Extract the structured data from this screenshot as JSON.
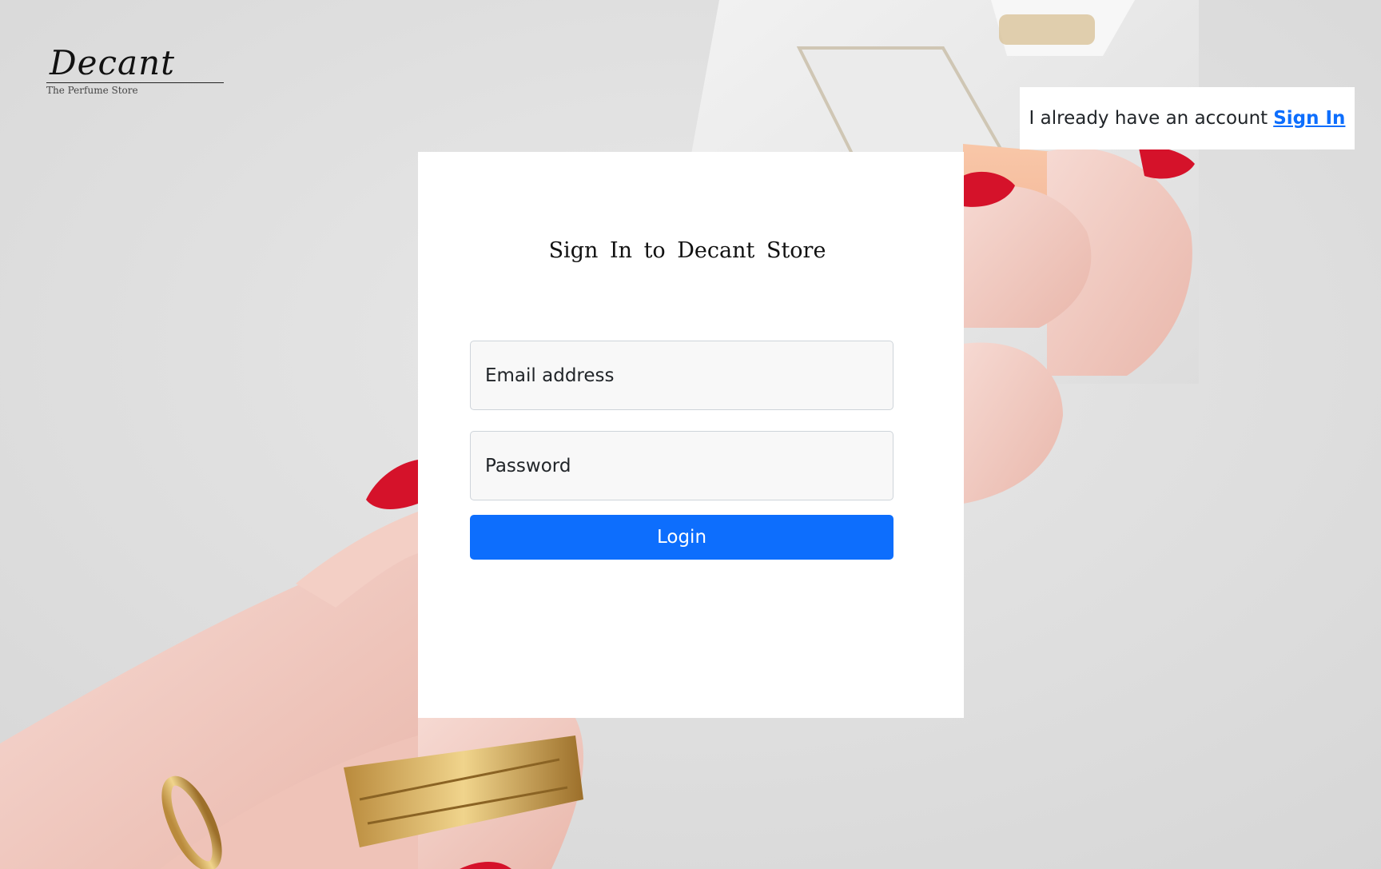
{
  "brand": {
    "name": "Decant",
    "tagline": "The Perfume Store"
  },
  "account_prompt": {
    "text": "I already have an account",
    "link_label": "Sign In"
  },
  "form": {
    "title": "Sign In to Decant Store",
    "email_placeholder": "Email address",
    "password_placeholder": "Password",
    "submit_label": "Login"
  },
  "colors": {
    "accent": "#0d6efd",
    "nail_polish": "#d5122a",
    "card_background": "#ffffff"
  }
}
